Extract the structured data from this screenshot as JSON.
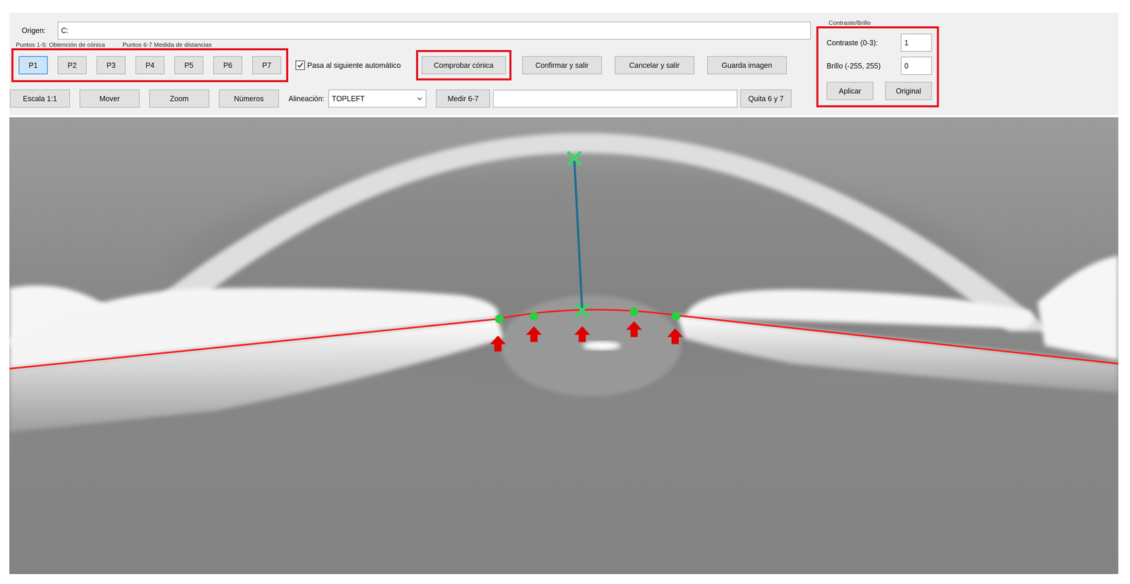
{
  "origin": {
    "label": "Origen:",
    "value": "C:"
  },
  "hint": {
    "left": "Puntos 1-5: Obtención de cónica",
    "right": "Puntos 6-7 Medida de distancias"
  },
  "point_buttons": {
    "highlighted": true,
    "items": [
      {
        "label": "P1",
        "selected": true
      },
      {
        "label": "P2",
        "selected": false
      },
      {
        "label": "P3",
        "selected": false
      },
      {
        "label": "P4",
        "selected": false
      },
      {
        "label": "P5",
        "selected": false
      },
      {
        "label": "P6",
        "selected": false
      },
      {
        "label": "P7",
        "selected": false
      }
    ]
  },
  "auto_next": {
    "label": "Pasa al siguiente automático",
    "checked": true
  },
  "actions": [
    {
      "label": "Comprobar cónica",
      "highlighted": true
    },
    {
      "label": "Confirmar y salir",
      "highlighted": false
    },
    {
      "label": "Cancelar y salir",
      "highlighted": false
    },
    {
      "label": "Guarda imagen",
      "highlighted": false
    }
  ],
  "view_buttons": [
    "Escala 1:1",
    "Mover",
    "Zoom",
    "Números"
  ],
  "alignment": {
    "label": "Alineación:",
    "value": "TOPLEFT"
  },
  "measure": {
    "button": "Medir 6-7",
    "value": "",
    "clear": "Quita 6 y 7"
  },
  "contrast_brightness": {
    "title": "Contraste/Brillo",
    "highlighted": true,
    "contrast": {
      "label": "Contraste (0-3):",
      "value": "1"
    },
    "brightness": {
      "label": "Brillo (-255, 255)",
      "value": "0"
    },
    "buttons": [
      "Aplicar",
      "Original"
    ]
  }
}
